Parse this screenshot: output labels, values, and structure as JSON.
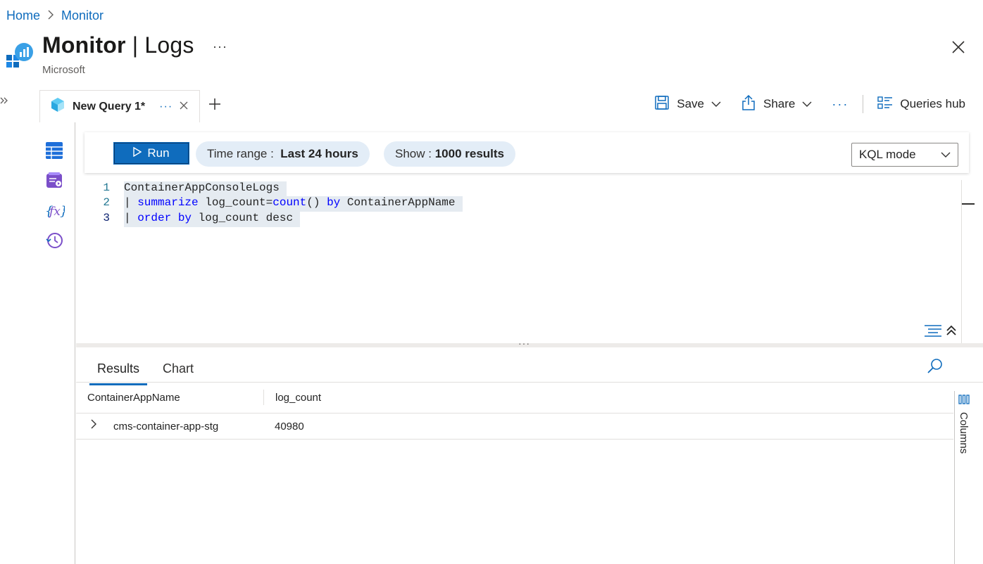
{
  "breadcrumb": {
    "items": [
      "Home",
      "Monitor"
    ]
  },
  "header": {
    "title_main": "Monitor",
    "title_sep": " | ",
    "title_sub": "Logs",
    "subtitle": "Microsoft",
    "more_label": "···"
  },
  "tabs": {
    "query_tab": {
      "label": "New Query 1*",
      "more": "···",
      "close": "×"
    },
    "add": "+"
  },
  "toolbar": {
    "save_label": "Save",
    "share_label": "Share",
    "more_label": "···",
    "queries_hub_label": "Queries hub"
  },
  "runbar": {
    "run_label": "Run",
    "time_range_label": "Time range :",
    "time_range_value": "Last 24 hours",
    "show_label": "Show :",
    "show_value": "1000 results",
    "mode_value": "KQL mode"
  },
  "editor": {
    "line_numbers": [
      "1",
      "2",
      "3"
    ],
    "lines": [
      [
        {
          "t": "ContainerAppConsoleLogs",
          "k": "txt"
        }
      ],
      [
        {
          "t": "| ",
          "k": "txt"
        },
        {
          "t": "summarize",
          "k": "kw"
        },
        {
          "t": " log_count=",
          "k": "txt"
        },
        {
          "t": "count",
          "k": "kw"
        },
        {
          "t": "() ",
          "k": "txt"
        },
        {
          "t": "by",
          "k": "kw"
        },
        {
          "t": " ContainerAppName",
          "k": "txt"
        }
      ],
      [
        {
          "t": "| ",
          "k": "txt"
        },
        {
          "t": "order",
          "k": "kw"
        },
        {
          "t": " ",
          "k": "txt"
        },
        {
          "t": "by",
          "k": "kw"
        },
        {
          "t": " log_count desc",
          "k": "txt"
        }
      ]
    ],
    "splitter_dots": "···"
  },
  "results": {
    "tabs": [
      "Results",
      "Chart"
    ],
    "columns": [
      "ContainerAppName",
      "log_count"
    ],
    "rows": [
      [
        "cms-container-app-stg",
        "40980"
      ]
    ],
    "columns_panel_label": "Columns"
  },
  "colors": {
    "accent": "#0f6cbd",
    "pill_bg": "#e3edf7",
    "code_highlight": "#e5ebf1",
    "keyword": "#0000ff"
  }
}
